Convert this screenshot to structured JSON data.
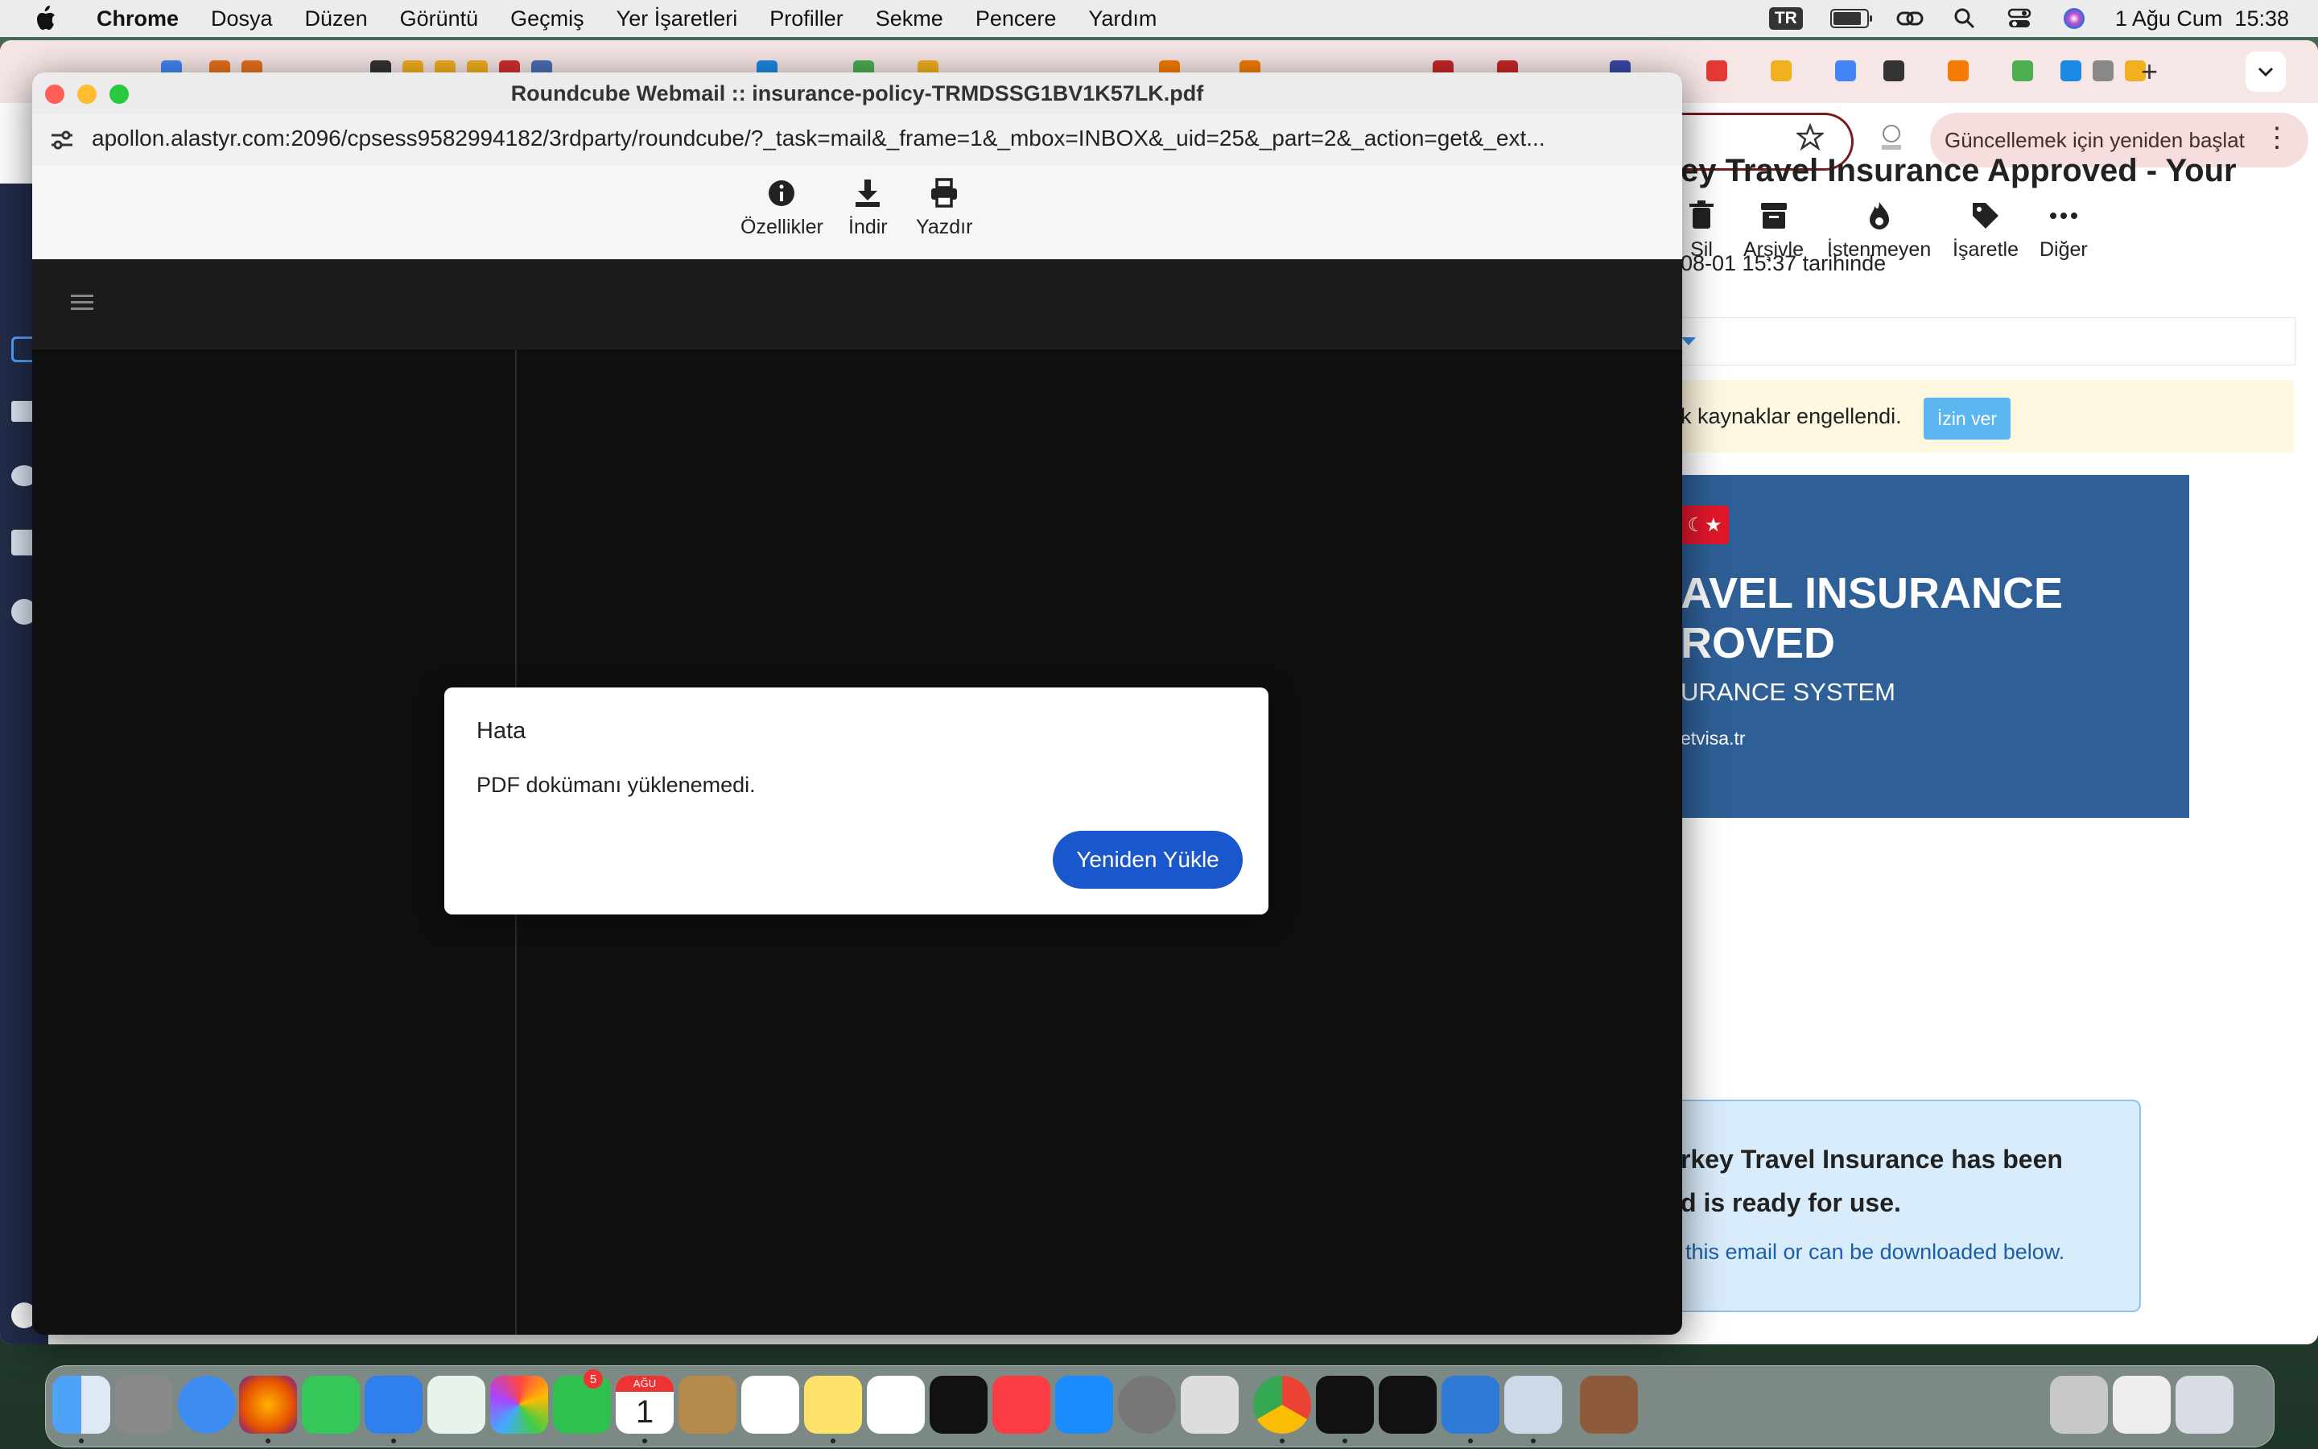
{
  "menubar": {
    "app": "Chrome",
    "items": [
      "Dosya",
      "Düzen",
      "Görüntü",
      "Geçmiş",
      "Yer İşaretleri",
      "Profiller",
      "Sekme",
      "Pencere",
      "Yardım"
    ],
    "input_source": "TR",
    "battery_level": 0.85,
    "datetime": "1 Ağu Cum  15:38"
  },
  "background_window": {
    "update_button": "Güncellemek için yeniden başlat",
    "mail_toolbar": [
      "Sil",
      "Arşivle",
      "İstenmeyen",
      "İşaretle",
      "Diğer"
    ],
    "subject_fragment": "ey Travel Insurance Approved - Your",
    "date_fragment": "08-01 15:37 tarihinde",
    "blocked_text": "k kaynaklar engellendi.",
    "allow_button": "İzin ver",
    "flag": "☾★",
    "banner_line1": "AVEL INSURANCE",
    "banner_line2": "ROVED",
    "banner_line3": "URANCE SYSTEM",
    "banner_line4": "etvisa.tr",
    "info_line1": "rkey Travel Insurance has been",
    "info_line2": "d is ready for use.",
    "info_line3": "this email or can be downloaded below."
  },
  "popup": {
    "title": "Roundcube Webmail :: insurance-policy-TRMDSSG1BV1K57LK.pdf",
    "url": "apollon.alastyr.com:2096/cpsess9582994182/3rdparty/roundcube/?_task=mail&_frame=1&_mbox=INBOX&_uid=25&_part=2&_action=get&_ext...",
    "toolbar": {
      "properties": "Özellikler",
      "download": "İndir",
      "print": "Yazdır"
    }
  },
  "dialog": {
    "title": "Hata",
    "message": "PDF dokümanı yüklenemedi.",
    "reload_button": "Yeniden Yükle"
  },
  "dock": {
    "facetime_badge": "5",
    "calendar_month": "AĞU",
    "calendar_day": "1"
  },
  "colors": {
    "dialog_button": "#1a56cc",
    "update_pill": "#f6dede",
    "banner_blue": "#2e5f96"
  }
}
